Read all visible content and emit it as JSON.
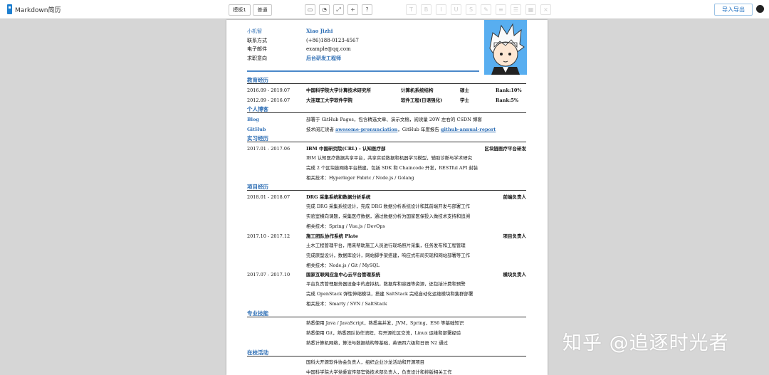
{
  "app": {
    "title": "Markdown简历"
  },
  "toolbar": {
    "template_label": "模板1",
    "style_label": "普通",
    "export_label": "导入导出",
    "view_icons": [
      "layout-icon",
      "theme-icon",
      "fullscreen-icon",
      "add-icon",
      "help-icon"
    ],
    "format_icons": [
      "text-icon",
      "bold-icon",
      "italic-icon",
      "underline-icon",
      "strike-icon",
      "brush-icon",
      "list-icon",
      "align-icon",
      "table-icon",
      "clear-icon"
    ]
  },
  "resume": {
    "basic": [
      {
        "k": "小机智",
        "v": "Xiao Jizhi",
        "highlight": true
      },
      {
        "k": "联系方式",
        "v": "(+86)188-0123-4567"
      },
      {
        "k": "电子邮件",
        "v": "example@qq.com"
      },
      {
        "k": "求职意向",
        "v": "后台研发工程师",
        "highlight": true
      }
    ],
    "sections": {
      "education": "教育经历",
      "blog": "个人博客",
      "intern": "实习经历",
      "projects": "项目经历",
      "skills": "专业技能",
      "campus": "在校活动"
    },
    "education": [
      {
        "date": "2016.09 - 2019.07",
        "school": "中国科学院大学计算技术研究所",
        "major": "计算机系统结构",
        "degree": "硕士",
        "rank": "Rank:10%"
      },
      {
        "date": "2012.09 - 2016.07",
        "school": "大连理工大学软件学院",
        "major": "软件工程(日语强化)",
        "degree": "学士",
        "rank": "Rank:5%"
      }
    ],
    "blog": [
      {
        "label": "Blog",
        "text": "部署于 GitHub Pages，包含精选文章、演示文稿，阅读量 20W 左右的 CSDN 博客"
      },
      {
        "label": "GitHub",
        "pre": "技术阅汇读者 ",
        "link1": "awesome-pronunciation",
        "mid": "，GitHub 年度报告 ",
        "link2": "github-annual-report"
      }
    ],
    "intern": {
      "date": "2017.01 - 2017.06",
      "title": "IBM 中国研究院(CRL) - 认知医疗部",
      "role": "区块链医疗平台研发",
      "bullets": [
        "IBM 认知医疗数据共享平台，共享实验数据和机器学习模型，辅助诊断与学术研究",
        "完成 2 个区块链网络平台搭建，包括 SDK 和 Chaincode 开发，RESTful API 封装",
        "相关技术：Hyperleger Fabric / Node.js / Golang"
      ]
    },
    "projects": [
      {
        "date": "2018.01 - 2018.07",
        "title": "DRG 采集系统和数据分析系统",
        "role": "前端负责人",
        "bullets": [
          "完成 DRG 采集系统设计，完成 DRG 数据分析系统设计和其前端开发与部署工作",
          "实验室横向课题，采集医疗数据，通过数据分析为国家医保投入做技术支持和追溯",
          "相关技术：Spring / Vue.js / DevOps"
        ]
      },
      {
        "date": "2017.10 - 2017.12",
        "title": "施工团队协作系统 Plate",
        "role": "项目负责人",
        "bullets": [
          "土木工程管理平台，用来帮助施工人员进行现场照片采集，任务发布和工程管理",
          "完成原型设计，数据库设计，网站脚手架搭建，响应式布局实现和网站部署等工作",
          "相关技术：Node.js / Git / MySQL"
        ]
      },
      {
        "date": "2017.07 - 2017.10",
        "title": "国家互联网应急中心云平台管理系统",
        "role": "模块负责人",
        "bullets": [
          "平台负责管理服务器设备中的虚拟机，数据库和容器等资源，还包括计费和预警",
          "完成 OpenStack 弹性伸缩模块，搭建 SaltStack 完成自动化运维模块和集群部署",
          "相关技术：Smarty / SVN / SaltStack"
        ]
      }
    ],
    "skills": [
      "熟悉使用 Java / JavaScript，熟悉高并发，JVM，Spring，ES6 等基础知识",
      "熟悉使用 Git，熟悉团队协作流程，有开源社区交流，Linux 运维和部署经验",
      "熟悉计算机网络，算法与数据结构等基础，英语四六级和日语 N2 通过"
    ],
    "campus": [
      "国科大开源软件协会负责人，组织企业沙龙活动和开源项目",
      "中国科学院大学党委宣传部官微技术部负责人，负责设计和排版相关工作"
    ]
  },
  "watermark": "知乎 @追逐时光者",
  "colors": {
    "accent": "#2f6fb5",
    "photo_bg": "#58aef0",
    "background": "#d6d6d6"
  }
}
